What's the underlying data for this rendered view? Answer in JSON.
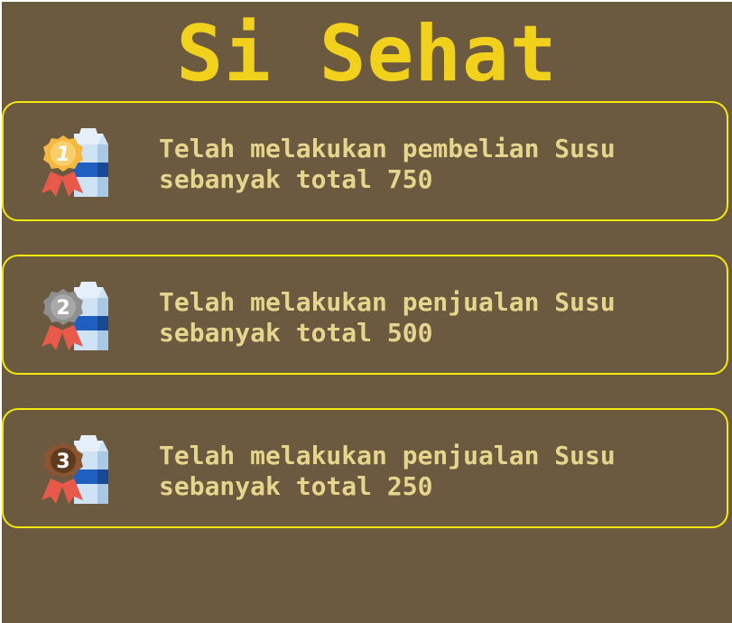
{
  "title": "Si Sehat",
  "achievements": [
    {
      "rank": "1",
      "medal": "gold-medal-icon",
      "color": "#f5b942",
      "text": "Telah melakukan pembelian Susu\nsebanyak total 750"
    },
    {
      "rank": "2",
      "medal": "silver-medal-icon",
      "color": "#9a9a9a",
      "text": "Telah melakukan penjualan Susu\nsebanyak total 500"
    },
    {
      "rank": "3",
      "medal": "bronze-medal-icon",
      "color": "#8a5530",
      "text": "Telah melakukan penjualan Susu\nsebanyak total 250"
    }
  ],
  "colors": {
    "background": "#6b5a3f",
    "title": "#f1d11c",
    "card_border": "#f4e80c",
    "text": "#e6d58c"
  }
}
